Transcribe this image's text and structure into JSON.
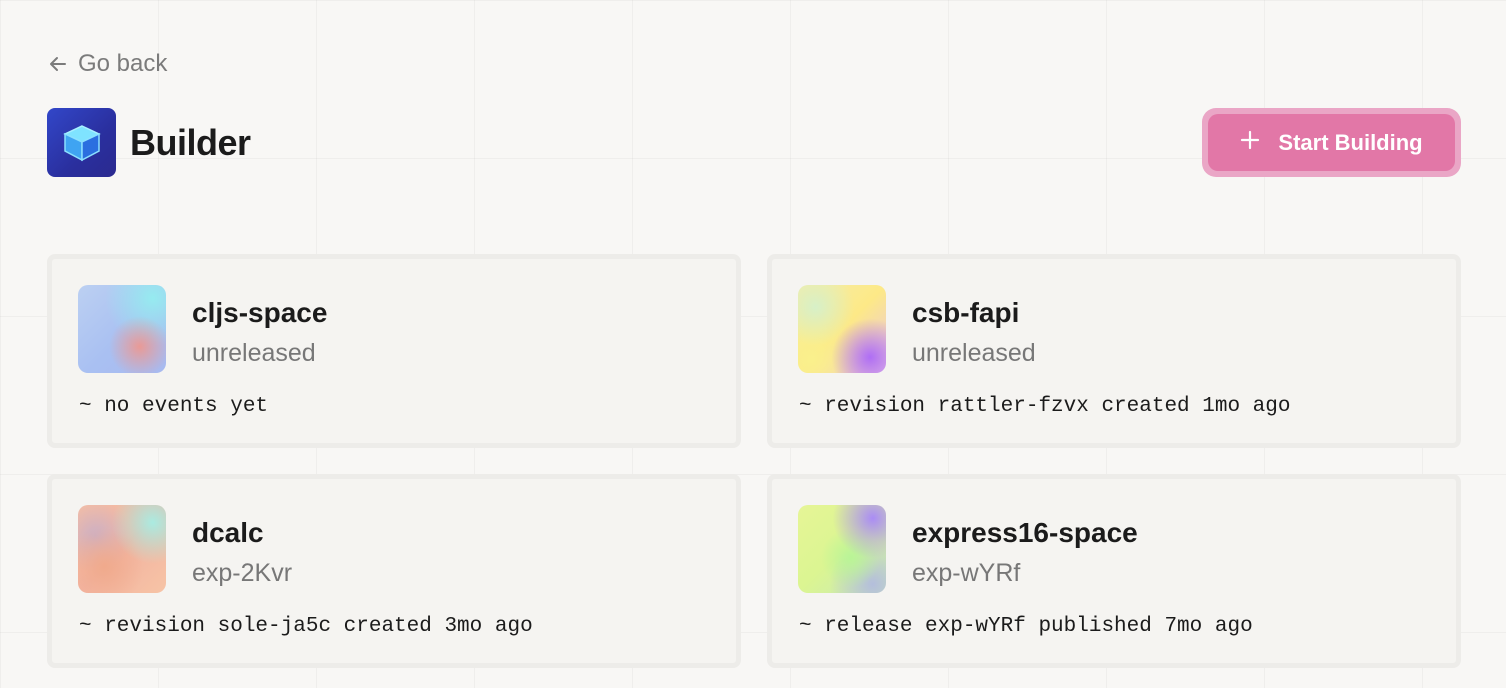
{
  "nav": {
    "back_label": "Go back"
  },
  "header": {
    "title": "Builder",
    "logo_icon": "cube-icon"
  },
  "actions": {
    "start_building_label": "Start Building",
    "start_building_icon": "plus-icon"
  },
  "colors": {
    "accent": "#e277a7",
    "accent_border": "#eaa6c6",
    "logo_bg": "#2f3bb5"
  },
  "projects": [
    {
      "name": "cljs-space",
      "status": "unreleased",
      "event": "~ no events yet"
    },
    {
      "name": "csb-fapi",
      "status": "unreleased",
      "event": "~ revision rattler-fzvx created 1mo ago"
    },
    {
      "name": "dcalc",
      "status": "exp-2Kvr",
      "event": "~ revision sole-ja5c created 3mo ago"
    },
    {
      "name": "express16-space",
      "status": "exp-wYRf",
      "event": "~ release exp-wYRf published 7mo ago"
    }
  ]
}
